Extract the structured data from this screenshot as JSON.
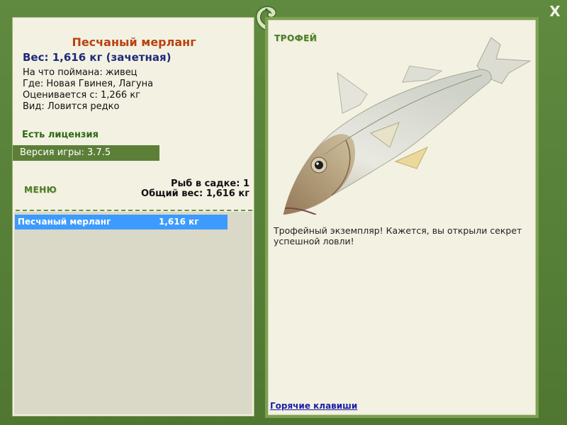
{
  "fish": {
    "name": "Песчаный мерланг",
    "weight_line": "Вес: 1,616 кг (зачетная)",
    "caught_on": "На что поймана: живец",
    "where": "Где: Новая Гвинея, Лагуна",
    "rated_from": "Оценивается с: 1,266 кг",
    "kind": "Вид: Ловится редко"
  },
  "license": "Есть лицензия",
  "game_version": "Версия игры: 3.7.5",
  "menu_label": "МЕНЮ",
  "cage": {
    "count_line": "Рыб в садке: 1",
    "total_line": "Общий вес: 1,616 кг",
    "rows": [
      {
        "name": "Песчаный мерланг",
        "weight": "1,616 кг"
      }
    ]
  },
  "trophy": {
    "label": "ТРОФЕЙ",
    "description": "Трофейный экземпляр! Кажется, вы открыли секрет успешной ловли!"
  },
  "hotkeys_link": "Горячие клавиши",
  "close_label": "X",
  "colors": {
    "frame": "#587f3a",
    "panel": "#f3f1e2",
    "title": "#b8420f",
    "weight": "#1f2a7a",
    "highlight": "#3d9bff"
  }
}
